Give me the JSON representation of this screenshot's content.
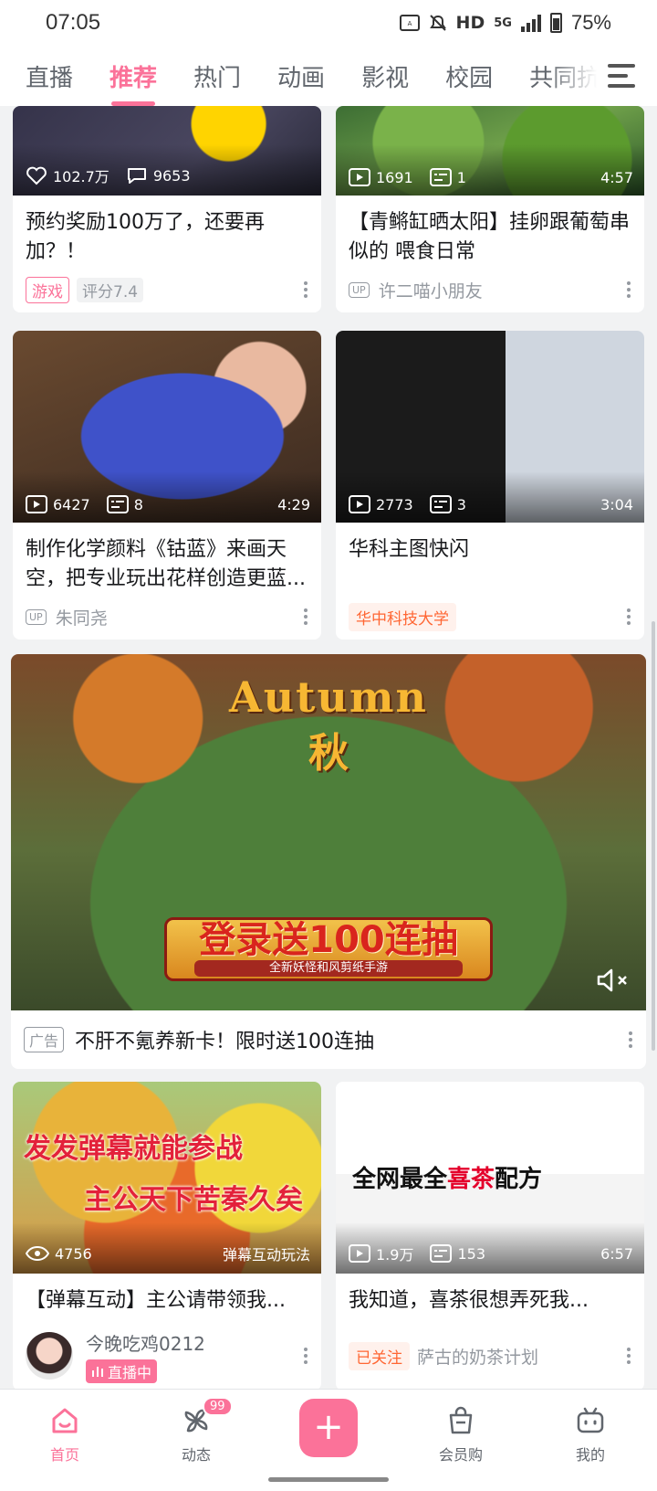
{
  "status_bar": {
    "time": "07:05",
    "network": "HD",
    "network_gen": "5G",
    "battery": "75%"
  },
  "tabs": [
    {
      "label": "直播",
      "active": false
    },
    {
      "label": "推荐",
      "active": true
    },
    {
      "label": "热门",
      "active": false
    },
    {
      "label": "动画",
      "active": false
    },
    {
      "label": "影视",
      "active": false
    },
    {
      "label": "校园",
      "active": false
    },
    {
      "label": "共同抗",
      "active": false
    }
  ],
  "cards": [
    {
      "title": "预约奖励100万了，还要再加？！",
      "stat1": "102.7万",
      "stat2": "9653",
      "tag": "游戏",
      "meta": "评分7.4"
    },
    {
      "title": "【青鳉缸晒太阳】挂卵跟葡萄串似的 喂食日常",
      "views": "1691",
      "danmaku": "1",
      "duration": "4:57",
      "up_badge": "UP",
      "author": "许二喵小朋友"
    },
    {
      "title": "制作化学颜料《钴蓝》来画天空，把专业玩出花样创造更蓝...",
      "views": "6427",
      "danmaku": "8",
      "duration": "4:29",
      "up_badge": "UP",
      "author": "朱同尧"
    },
    {
      "title": "华科主图快闪",
      "views": "2773",
      "danmaku": "3",
      "duration": "3:04",
      "org_tag": "华中科技大学"
    },
    {
      "title": "【弹幕互动】主公请带领我...",
      "views": "4756",
      "corner": "弹幕互动玩法",
      "thumb_text_1": "发发弹幕就能参战",
      "thumb_text_2": "主公天下苦秦久矣",
      "author": "今晚吃鸡0212",
      "live_badge": "直播中"
    },
    {
      "title": "我知道，喜茶很想弄死我...",
      "views": "1.9万",
      "danmaku": "153",
      "duration": "6:57",
      "thumb_text": "全网最全",
      "thumb_brand": "喜茶",
      "thumb_suffix": "配方",
      "follow_tag": "已关注",
      "author": "萨古的奶茶计划"
    }
  ],
  "ad": {
    "title_en": "Autumn",
    "title_cn": "秋",
    "banner_big": "登录送100连抽",
    "banner_small": "全新妖怪和风剪纸手游",
    "tag": "广告",
    "text": "不肝不氪养新卡！限时送100连抽"
  },
  "bottom_nav": [
    {
      "label": "首页",
      "active": true,
      "icon": "home-icon"
    },
    {
      "label": "动态",
      "active": false,
      "icon": "pinwheel-icon",
      "badge": "99"
    },
    {
      "label": "会员购",
      "active": false,
      "icon": "shopping-bag-icon"
    },
    {
      "label": "我的",
      "active": false,
      "icon": "tv-icon"
    }
  ],
  "colors": {
    "accent": "#fb7299",
    "text": "#18191c",
    "muted": "#9499a0",
    "org": "#ff6633"
  }
}
